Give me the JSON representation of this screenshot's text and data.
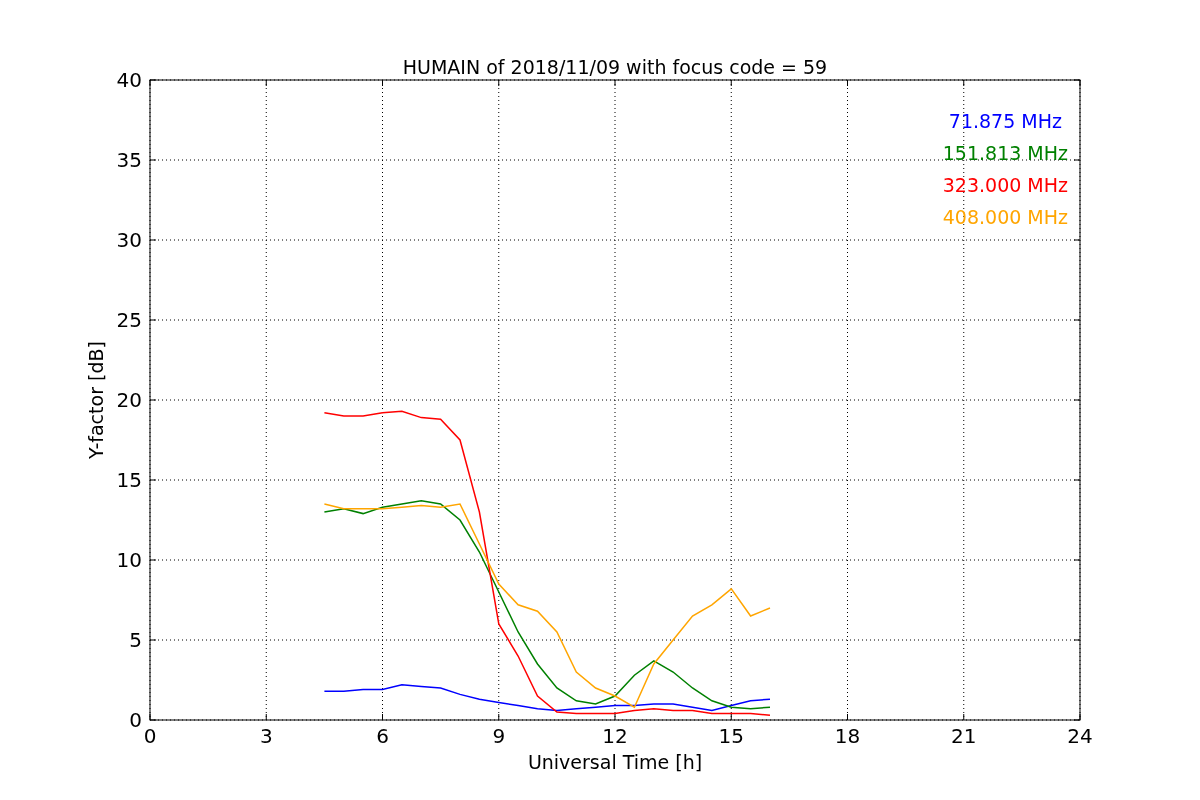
{
  "chart_data": {
    "type": "line",
    "title": "HUMAIN of 2018/11/09 with focus code = 59",
    "xlabel": "Universal Time [h]",
    "ylabel": "Y-factor [dB]",
    "x": [
      4.5,
      5,
      5.5,
      6,
      6.5,
      7,
      7.5,
      8,
      8.5,
      9,
      9.5,
      10,
      10.5,
      11,
      11.5,
      12,
      12.5,
      13,
      13.5,
      14,
      14.5,
      15,
      15.5,
      16
    ],
    "series": [
      {
        "name": "71.875 MHz",
        "color": "#0000ff",
        "values": [
          1.8,
          1.8,
          1.9,
          1.9,
          2.2,
          2.1,
          2.0,
          1.6,
          1.3,
          1.1,
          0.9,
          0.7,
          0.6,
          0.7,
          0.8,
          0.9,
          0.9,
          1.0,
          1.0,
          0.8,
          0.6,
          0.9,
          1.2,
          1.3
        ]
      },
      {
        "name": "151.813 MHz",
        "color": "#008000",
        "values": [
          13,
          13.2,
          12.9,
          13.3,
          13.5,
          13.7,
          13.5,
          12.5,
          10.5,
          8,
          5.5,
          3.5,
          2.0,
          1.2,
          1.0,
          1.5,
          2.8,
          3.7,
          3.0,
          2.0,
          1.2,
          0.8,
          0.7,
          0.8
        ]
      },
      {
        "name": "323.000 MHz",
        "color": "#ff0000",
        "values": [
          19.2,
          19.0,
          19.0,
          19.2,
          19.3,
          18.9,
          18.8,
          17.5,
          13,
          6,
          4,
          1.5,
          0.5,
          0.4,
          0.4,
          0.4,
          0.6,
          0.7,
          0.6,
          0.6,
          0.4,
          0.4,
          0.4,
          0.3
        ]
      },
      {
        "name": "408.000 MHz",
        "color": "#ffa500",
        "values": [
          13.5,
          13.2,
          13.2,
          13.2,
          13.3,
          13.4,
          13.3,
          13.5,
          11,
          8.5,
          7.2,
          6.8,
          5.5,
          3.0,
          2.0,
          1.5,
          0.8,
          3.5,
          5.0,
          6.5,
          7.2,
          8.2,
          6.5,
          7.0
        ]
      }
    ],
    "xlim": [
      0,
      24
    ],
    "ylim": [
      0,
      40
    ],
    "xticks": [
      0,
      3,
      6,
      9,
      12,
      15,
      18,
      21,
      24
    ],
    "yticks": [
      0,
      5,
      10,
      15,
      20,
      25,
      30,
      35,
      40
    ],
    "grid": true
  }
}
